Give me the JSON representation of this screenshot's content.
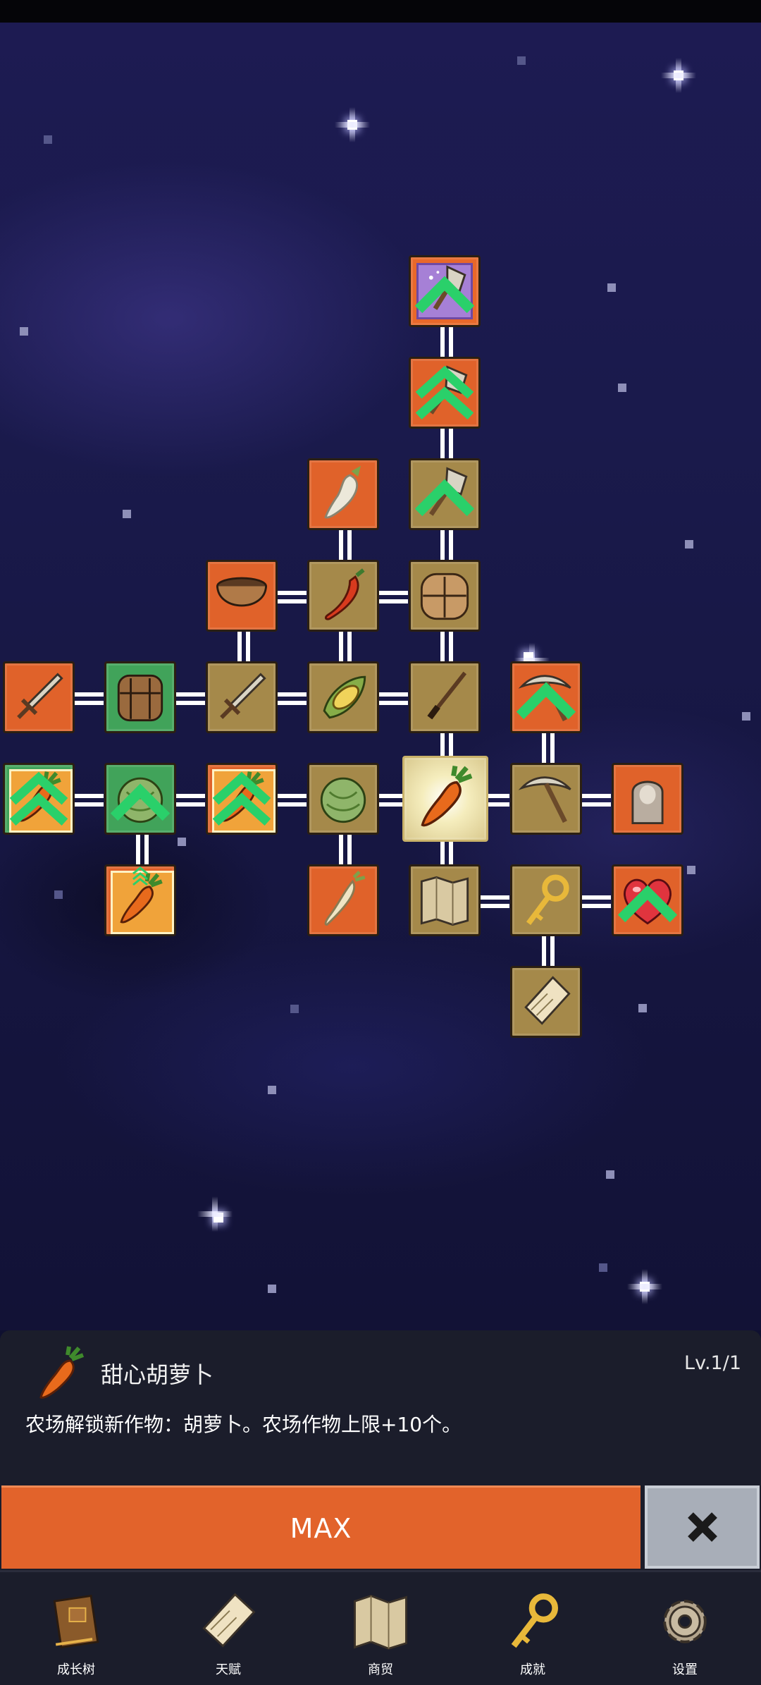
{
  "skill_tree": {
    "nodes": [
      {
        "name": "magic-shovel",
        "icon": "magic-shovel-icon",
        "tile": "purple",
        "upgrade": 1
      },
      {
        "name": "shovel-2",
        "icon": "shovel-icon",
        "tile": "orange",
        "upgrade": 2
      },
      {
        "name": "radish",
        "icon": "radish-icon",
        "tile": "orange",
        "upgrade": 0
      },
      {
        "name": "shovel-1",
        "icon": "shovel-icon",
        "tile": "tan",
        "upgrade": 1
      },
      {
        "name": "wooden-bowl",
        "icon": "bowl-icon",
        "tile": "orange",
        "upgrade": 0
      },
      {
        "name": "chili-pepper",
        "icon": "pepper-icon",
        "tile": "tan",
        "upgrade": 0
      },
      {
        "name": "bread",
        "icon": "bread-icon",
        "tile": "tan",
        "upgrade": 0
      },
      {
        "name": "sword-1",
        "icon": "sword-icon",
        "tile": "orange",
        "upgrade": 0
      },
      {
        "name": "backpack",
        "icon": "backpack-icon",
        "tile": "green",
        "upgrade": 0
      },
      {
        "name": "sword-2",
        "icon": "sword-icon",
        "tile": "tan",
        "upgrade": 0
      },
      {
        "name": "corn",
        "icon": "corn-icon",
        "tile": "tan",
        "upgrade": 0
      },
      {
        "name": "fishing-rod",
        "icon": "rod-icon",
        "tile": "tan",
        "upgrade": 0
      },
      {
        "name": "pickaxe-2",
        "icon": "pickaxe-icon",
        "tile": "orange",
        "upgrade": 1
      },
      {
        "name": "carrot-boost-1",
        "icon": "carrot-icon",
        "tile": "green",
        "upgrade": 2
      },
      {
        "name": "cabbage-1",
        "icon": "cabbage-icon",
        "tile": "green",
        "upgrade": 1
      },
      {
        "name": "carrot-boost-2",
        "icon": "carrot-icon",
        "tile": "orange",
        "upgrade": 2
      },
      {
        "name": "cabbage-2",
        "icon": "cabbage-icon",
        "tile": "tan",
        "upgrade": 0
      },
      {
        "name": "sweet-carrot",
        "icon": "carrot-icon",
        "tile": "selected",
        "upgrade": 0
      },
      {
        "name": "pickaxe-1",
        "icon": "pickaxe-icon",
        "tile": "tan",
        "upgrade": 0
      },
      {
        "name": "ghost",
        "icon": "ghost-icon",
        "tile": "orange",
        "upgrade": 0
      },
      {
        "name": "carrot-boost-3",
        "icon": "carrot-icon",
        "tile": "orange",
        "upgrade": 3
      },
      {
        "name": "parsnip",
        "icon": "parsnip-icon",
        "tile": "orange",
        "upgrade": 0
      },
      {
        "name": "map",
        "icon": "map-icon",
        "tile": "tan",
        "upgrade": 0
      },
      {
        "name": "golden-key",
        "icon": "key-icon",
        "tile": "tan",
        "upgrade": 0
      },
      {
        "name": "heart",
        "icon": "heart-icon",
        "tile": "orange",
        "upgrade": 1
      },
      {
        "name": "scroll",
        "icon": "scroll-icon",
        "tile": "tan",
        "upgrade": 0
      }
    ]
  },
  "info_panel": {
    "name": "甜心胡萝卜",
    "level": "Lv.1/1",
    "description": "农场解锁新作物：胡萝卜。农场作物上限+10个。",
    "icon": "carrot-icon"
  },
  "actions": {
    "max_label": "MAX",
    "close_icon": "close-icon"
  },
  "nav": {
    "items": [
      {
        "label": "成长树",
        "icon": "book-icon"
      },
      {
        "label": "天赋",
        "icon": "scroll-icon"
      },
      {
        "label": "商贸",
        "icon": "map-icon"
      },
      {
        "label": "成就",
        "icon": "key-icon"
      },
      {
        "label": "设置",
        "icon": "gear-icon"
      }
    ]
  },
  "colors": {
    "orange_tile": "#e0622a",
    "tan_tile": "#a5894a",
    "green_tile": "#41a35a",
    "purple_tile": "#a680d6",
    "max_button": "#e2632b",
    "close_button": "#a8aeb8",
    "panel": "#1b1d2b"
  }
}
